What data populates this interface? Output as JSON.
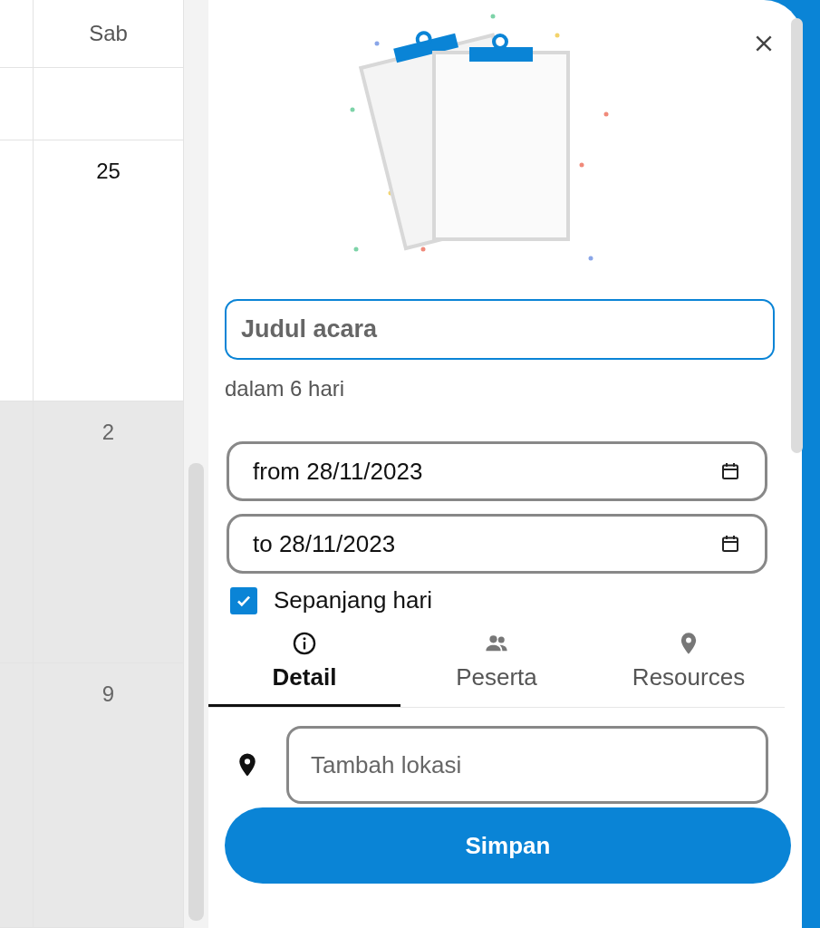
{
  "calendar": {
    "header": "Sab",
    "weeks": [
      {
        "day": "25",
        "other_month": false
      },
      {
        "day": "2",
        "other_month": true
      },
      {
        "day": "9",
        "other_month": true
      }
    ]
  },
  "panel": {
    "title_field": {
      "placeholder": "Judul acara",
      "focused": true
    },
    "relative_time": "dalam 6 hari",
    "date_fields": [
      {
        "value": "from 28/11/2023"
      },
      {
        "value": "to 28/11/2023"
      }
    ],
    "all_day": {
      "label": "Sepanjang hari",
      "checked": true
    },
    "tabs": [
      {
        "kind": "info",
        "label": "Detail",
        "selected": true
      },
      {
        "kind": "people",
        "label": "Peserta",
        "selected": false
      },
      {
        "kind": "pin",
        "label": "Resources",
        "selected": false
      }
    ],
    "location_field": {
      "placeholder": "Tambah lokasi"
    },
    "save_button": "Simpan"
  }
}
